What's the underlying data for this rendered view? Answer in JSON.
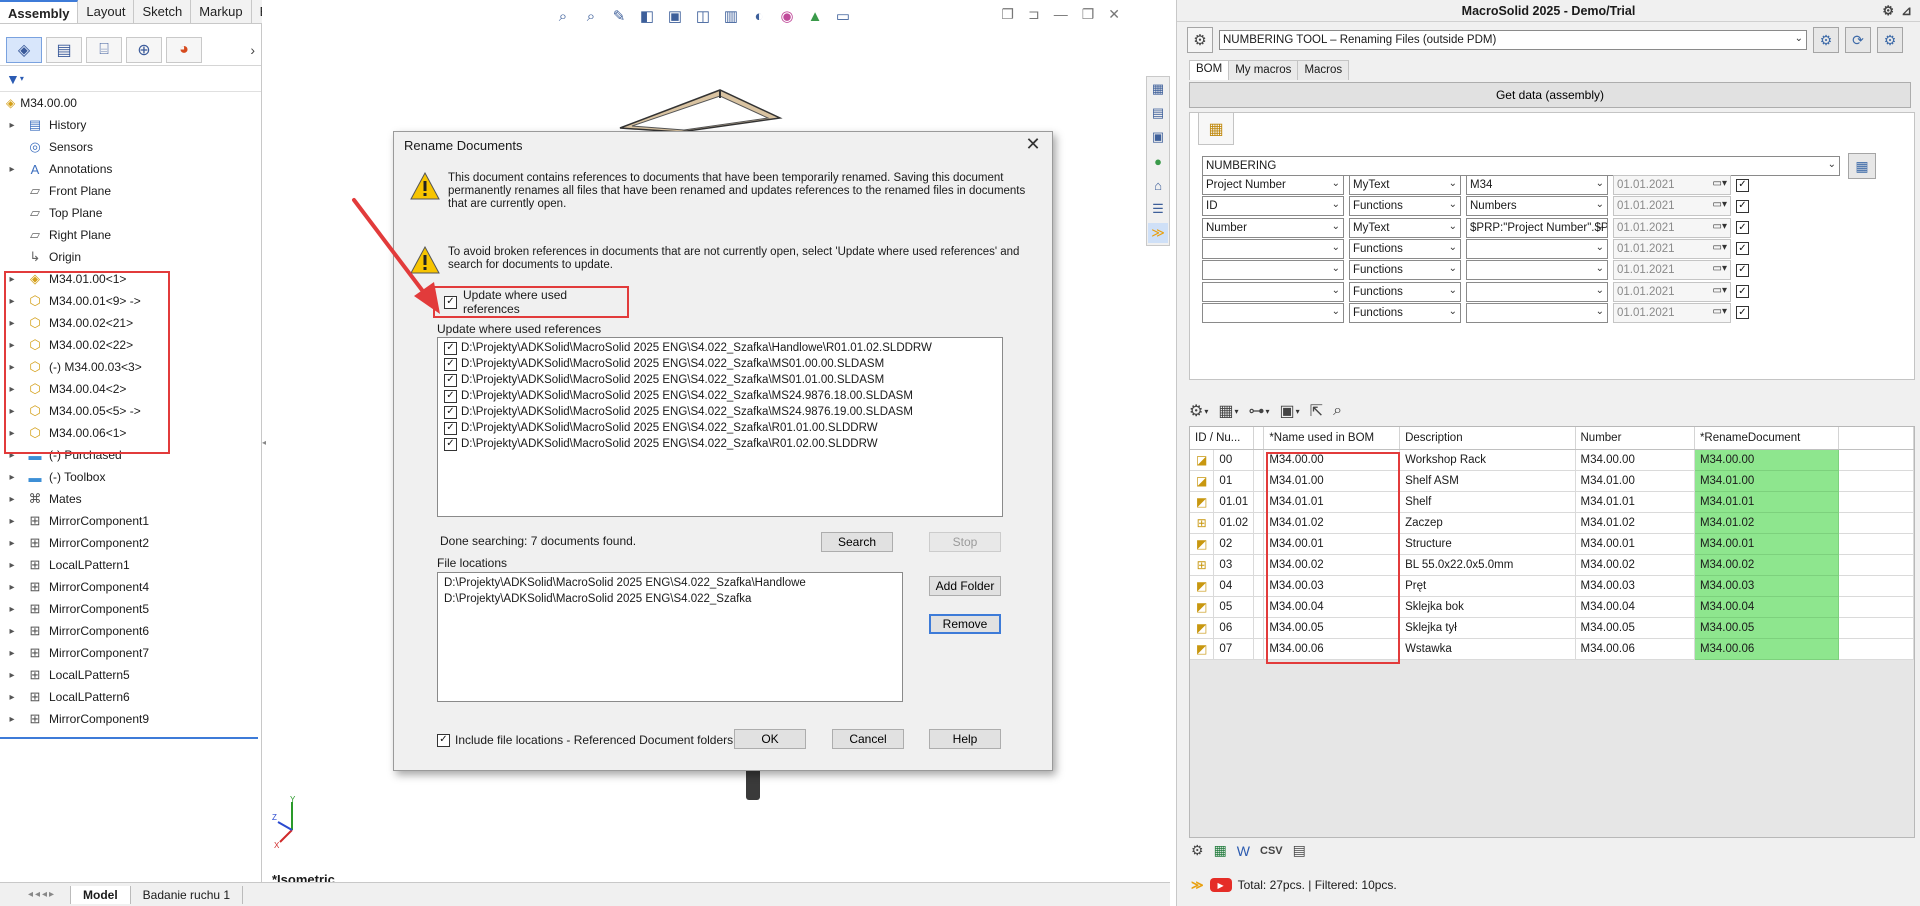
{
  "sw": {
    "tabs": [
      "Assembly",
      "Layout",
      "Sketch",
      "Markup",
      "Evaluate"
    ],
    "active_tab": "Assembly",
    "tree_root": "M34.00.00",
    "tree": [
      {
        "label": "History",
        "icon": "history-icon",
        "expand": "▸"
      },
      {
        "label": "Sensors",
        "icon": "sensors-icon",
        "expand": ""
      },
      {
        "label": "Annotations",
        "icon": "annotations-icon",
        "expand": "▸"
      },
      {
        "label": "Front Plane",
        "icon": "plane-icon",
        "expand": ""
      },
      {
        "label": "Top Plane",
        "icon": "plane-icon",
        "expand": ""
      },
      {
        "label": "Right Plane",
        "icon": "plane-icon",
        "expand": ""
      },
      {
        "label": "Origin",
        "icon": "origin-icon",
        "expand": ""
      },
      {
        "label": "M34.01.00<1>",
        "icon": "assembly-icon",
        "expand": "▸"
      },
      {
        "label": "M34.00.01<9> ->",
        "icon": "part-icon",
        "expand": "▸"
      },
      {
        "label": "M34.00.02<21>",
        "icon": "part-icon",
        "expand": "▸"
      },
      {
        "label": "M34.00.02<22>",
        "icon": "part-icon",
        "expand": "▸"
      },
      {
        "label": "(-) M34.00.03<3>",
        "icon": "part-icon",
        "expand": "▸"
      },
      {
        "label": "M34.00.04<2>",
        "icon": "part-icon",
        "expand": "▸"
      },
      {
        "label": "M34.00.05<5> ->",
        "icon": "part-icon",
        "expand": "▸"
      },
      {
        "label": "M34.00.06<1>",
        "icon": "part-icon",
        "expand": "▸"
      },
      {
        "label": "(-) Purchased",
        "icon": "folder-icon",
        "expand": "▸"
      },
      {
        "label": "(-) Toolbox",
        "icon": "folder-icon",
        "expand": "▸"
      },
      {
        "label": "Mates",
        "icon": "mates-icon",
        "expand": "▸"
      },
      {
        "label": "MirrorComponent1",
        "icon": "pattern-icon",
        "expand": "▸"
      },
      {
        "label": "MirrorComponent2",
        "icon": "pattern-icon",
        "expand": "▸"
      },
      {
        "label": "LocalLPattern1",
        "icon": "pattern-icon",
        "expand": "▸"
      },
      {
        "label": "MirrorComponent4",
        "icon": "pattern-icon",
        "expand": "▸"
      },
      {
        "label": "MirrorComponent5",
        "icon": "pattern-icon",
        "expand": "▸"
      },
      {
        "label": "MirrorComponent6",
        "icon": "pattern-icon",
        "expand": "▸"
      },
      {
        "label": "MirrorComponent7",
        "icon": "pattern-icon",
        "expand": "▸"
      },
      {
        "label": "LocalLPattern5",
        "icon": "pattern-icon",
        "expand": "▸"
      },
      {
        "label": "LocalLPattern6",
        "icon": "pattern-icon",
        "expand": "▸"
      },
      {
        "label": "MirrorComponent9",
        "icon": "pattern-icon",
        "expand": "▸"
      }
    ],
    "bottom_tabs": [
      "Model",
      "Badanie ruchu 1"
    ],
    "view_label": "*Isometric"
  },
  "dialog": {
    "title": "Rename Documents",
    "text1": "This document contains references to documents that have been temporarily renamed. Saving this document permanently renames all files that have been renamed and updates references to the renamed files in documents that are currently open.",
    "text2": "To avoid broken references in documents that are not currently open, select 'Update where used references' and search for documents to update.",
    "update_checkbox_label": "Update where used references",
    "list_label": "Update where used references",
    "references": [
      "D:\\Projekty\\ADKSolid\\MacroSolid 2025 ENG\\S4.022_Szafka\\Handlowe\\R01.01.02.SLDDRW",
      "D:\\Projekty\\ADKSolid\\MacroSolid 2025 ENG\\S4.022_Szafka\\MS01.00.00.SLDASM",
      "D:\\Projekty\\ADKSolid\\MacroSolid 2025 ENG\\S4.022_Szafka\\MS01.01.00.SLDASM",
      "D:\\Projekty\\ADKSolid\\MacroSolid 2025 ENG\\S4.022_Szafka\\MS24.9876.18.00.SLDASM",
      "D:\\Projekty\\ADKSolid\\MacroSolid 2025 ENG\\S4.022_Szafka\\MS24.9876.19.00.SLDASM",
      "D:\\Projekty\\ADKSolid\\MacroSolid 2025 ENG\\S4.022_Szafka\\R01.01.00.SLDDRW",
      "D:\\Projekty\\ADKSolid\\MacroSolid 2025 ENG\\S4.022_Szafka\\R01.02.00.SLDDRW"
    ],
    "done_text": "Done searching: 7 documents found.",
    "search_label": "Search",
    "stop_label": "Stop",
    "file_locations_label": "File locations",
    "locations": [
      "D:\\Projekty\\ADKSolid\\MacroSolid 2025 ENG\\S4.022_Szafka\\Handlowe",
      "D:\\Projekty\\ADKSolid\\MacroSolid 2025 ENG\\S4.022_Szafka"
    ],
    "add_folder_label": "Add Folder",
    "remove_label": "Remove",
    "include_label": "Include file locations - Referenced Document folders",
    "ok_label": "OK",
    "cancel_label": "Cancel",
    "help_label": "Help"
  },
  "ms": {
    "title": "MacroSolid 2025 - Demo/Trial",
    "tool_select": "NUMBERING TOOL – Renaming Files (outside PDM)",
    "tabs": [
      "BOM",
      "My macros",
      "Macros"
    ],
    "active_tab": "BOM",
    "get_data_label": "Get data (assembly)",
    "numbering_select": "NUMBERING",
    "criteria": [
      {
        "field": "Project Number",
        "type": "MyText",
        "value": "M34",
        "date": "01.01.2021"
      },
      {
        "field": "ID",
        "type": "Functions",
        "value": "Numbers",
        "date": "01.01.2021"
      },
      {
        "field": "Number",
        "type": "MyText",
        "value": "$PRP:\"Project Number\".$PRP:\"",
        "date": "01.01.2021"
      },
      {
        "field": "",
        "type": "Functions",
        "value": "",
        "date": "01.01.2021"
      },
      {
        "field": "",
        "type": "Functions",
        "value": "",
        "date": "01.01.2021"
      },
      {
        "field": "",
        "type": "Functions",
        "value": "",
        "date": "01.01.2021"
      },
      {
        "field": "",
        "type": "Functions",
        "value": "",
        "date": "01.01.2021"
      }
    ],
    "grid_headers": [
      "ID / Nu...",
      "*Name used in BOM",
      "Description",
      "Number",
      "*RenameDocument"
    ],
    "grid_rows": [
      {
        "id": "00",
        "name": "M34.00.00",
        "desc": "Workshop Rack",
        "number": "M34.00.00",
        "rename": "M34.00.00",
        "icon": "assembly-icon",
        "mark": false
      },
      {
        "id": "01",
        "name": "M34.01.00",
        "desc": "Shelf ASM",
        "number": "M34.01.00",
        "rename": "M34.01.00",
        "icon": "assembly-icon",
        "mark": true
      },
      {
        "id": "01.01",
        "name": "M34.01.01",
        "desc": "Shelf",
        "number": "M34.01.01",
        "rename": "M34.01.01",
        "icon": "part-icon",
        "mark": true
      },
      {
        "id": "01.02",
        "name": "M34.01.02",
        "desc": "Zaczep",
        "number": "M34.01.02",
        "rename": "M34.01.02",
        "icon": "pattern-icon",
        "mark": true
      },
      {
        "id": "02",
        "name": "M34.00.01",
        "desc": "Structure",
        "number": "M34.00.01",
        "rename": "M34.00.01",
        "icon": "part-icon",
        "mark": true
      },
      {
        "id": "03",
        "name": "M34.00.02",
        "desc": "BL 55.0x22.0x5.0mm",
        "number": "M34.00.02",
        "rename": "M34.00.02",
        "icon": "pattern-icon",
        "mark": false
      },
      {
        "id": "04",
        "name": "M34.00.03",
        "desc": "Pręt",
        "number": "M34.00.03",
        "rename": "M34.00.03",
        "icon": "part-icon",
        "mark": true
      },
      {
        "id": "05",
        "name": "M34.00.04",
        "desc": "Sklejka bok",
        "number": "M34.00.04",
        "rename": "M34.00.04",
        "icon": "part-icon",
        "mark": false
      },
      {
        "id": "06",
        "name": "M34.00.05",
        "desc": "Sklejka tył",
        "number": "M34.00.05",
        "rename": "M34.00.05",
        "icon": "part-icon",
        "mark": false
      },
      {
        "id": "07",
        "name": "M34.00.06",
        "desc": "Wstawka",
        "number": "M34.00.06",
        "rename": "M34.00.06",
        "icon": "part-icon",
        "mark": false
      }
    ],
    "footer_csv": "CSV",
    "status": "Total: 27pcs. | Filtered: 10pcs."
  },
  "colors": {
    "highlight": "#e23b3b",
    "rename_fill": "#8ee68e",
    "accent": "#3d7bd8"
  }
}
